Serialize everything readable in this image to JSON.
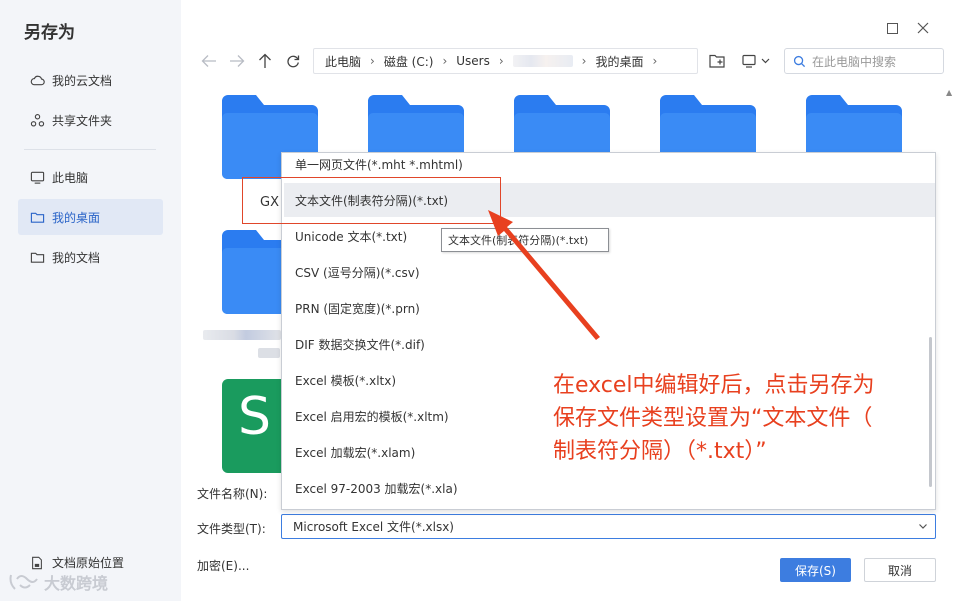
{
  "dialog": {
    "title": "另存为"
  },
  "sidebar": {
    "items": [
      {
        "label": "我的云文档",
        "icon": "cloud-icon"
      },
      {
        "label": "共享文件夹",
        "icon": "share-icon"
      },
      {
        "label": "此电脑",
        "icon": "monitor-icon"
      },
      {
        "label": "我的桌面",
        "icon": "folder-icon",
        "active": true
      },
      {
        "label": "我的文档",
        "icon": "folder-icon"
      }
    ],
    "bottom_label": "文档原始位置",
    "watermark": "大数跨境"
  },
  "path": {
    "crumbs": [
      "此电脑",
      "磁盘 (C:)",
      "Users",
      "",
      "我的桌面"
    ]
  },
  "search": {
    "placeholder": "在此电脑中搜索"
  },
  "files": {
    "label_gx": "GX",
    "app_icon_letter": "S"
  },
  "form": {
    "filename_label": "文件名称(N):",
    "filetype_label": "文件类型(T):",
    "encrypt_label": "加密(E)...",
    "filetype_value": "Microsoft Excel 文件(*.xlsx)"
  },
  "dropdown": {
    "options": [
      "单一网页文件(*.mht *.mhtml)",
      "文本文件(制表符分隔)(*.txt)",
      "Unicode 文本(*.txt)",
      "CSV (逗号分隔)(*.csv)",
      "PRN (固定宽度)(*.prn)",
      "DIF 数据交换文件(*.dif)",
      "Excel 模板(*.xltx)",
      "Excel 启用宏的模板(*.xltm)",
      "Excel 加载宏(*.xlam)",
      "Excel 97-2003 加载宏(*.xla)"
    ],
    "hovered_index": 1,
    "tooltip": "文本文件(制表符分隔)(*.txt)"
  },
  "annotation": {
    "lines": [
      "在excel中编辑好后，点击另存为",
      "保存文件类型设置为“文本文件（",
      "制表符分隔）（*.txt）”"
    ],
    "color": "#e8401f"
  },
  "buttons": {
    "save": "保存(S)",
    "cancel": "取消"
  },
  "colors": {
    "accent": "#3d7de0",
    "folder": "#2b7cf0",
    "sidebar_bg": "#f3f5f9"
  }
}
